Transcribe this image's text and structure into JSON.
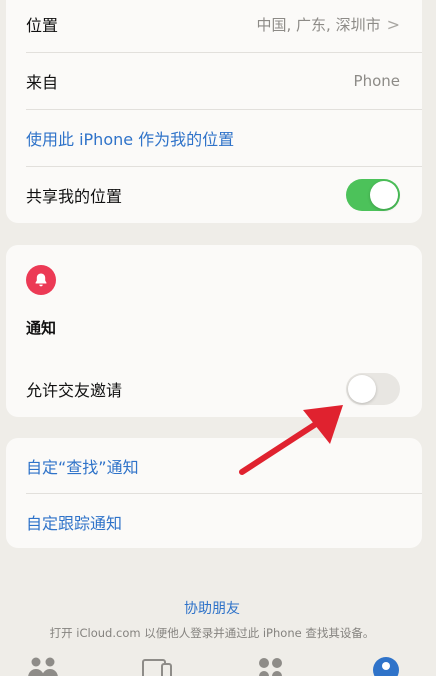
{
  "location_card": {
    "location_label": "位置",
    "location_value": "中国, 广东, 深圳市",
    "chevron": ">",
    "from_label": "来自",
    "from_value": "Phone",
    "use_this_iphone": "使用此 iPhone 作为我的位置",
    "share_location_label": "共享我的位置",
    "share_location_on": true
  },
  "notifications_card": {
    "icon": "bell-icon",
    "icon_color": "#ec3a55",
    "title": "通知",
    "allow_friend_invites_label": "允许交友邀请",
    "allow_friend_invites_on": false
  },
  "custom_card": {
    "custom_find_notifications": "自定“查找”通知",
    "custom_tracking_notifications": "自定跟踪通知"
  },
  "footer": {
    "help_friend_link": "协助朋友",
    "help_friend_desc": "打开 iCloud.com 以便他人登录并通过此 iPhone 查找其设备。"
  },
  "tabbar": {
    "tabs": [
      "people-icon",
      "devices-icon",
      "items-icon",
      "me-icon"
    ],
    "active_color": "#2f73c9"
  },
  "colors": {
    "accent": "#2f73c9",
    "toggle_on": "#4cc25a",
    "annotation_arrow": "#e0222f"
  }
}
